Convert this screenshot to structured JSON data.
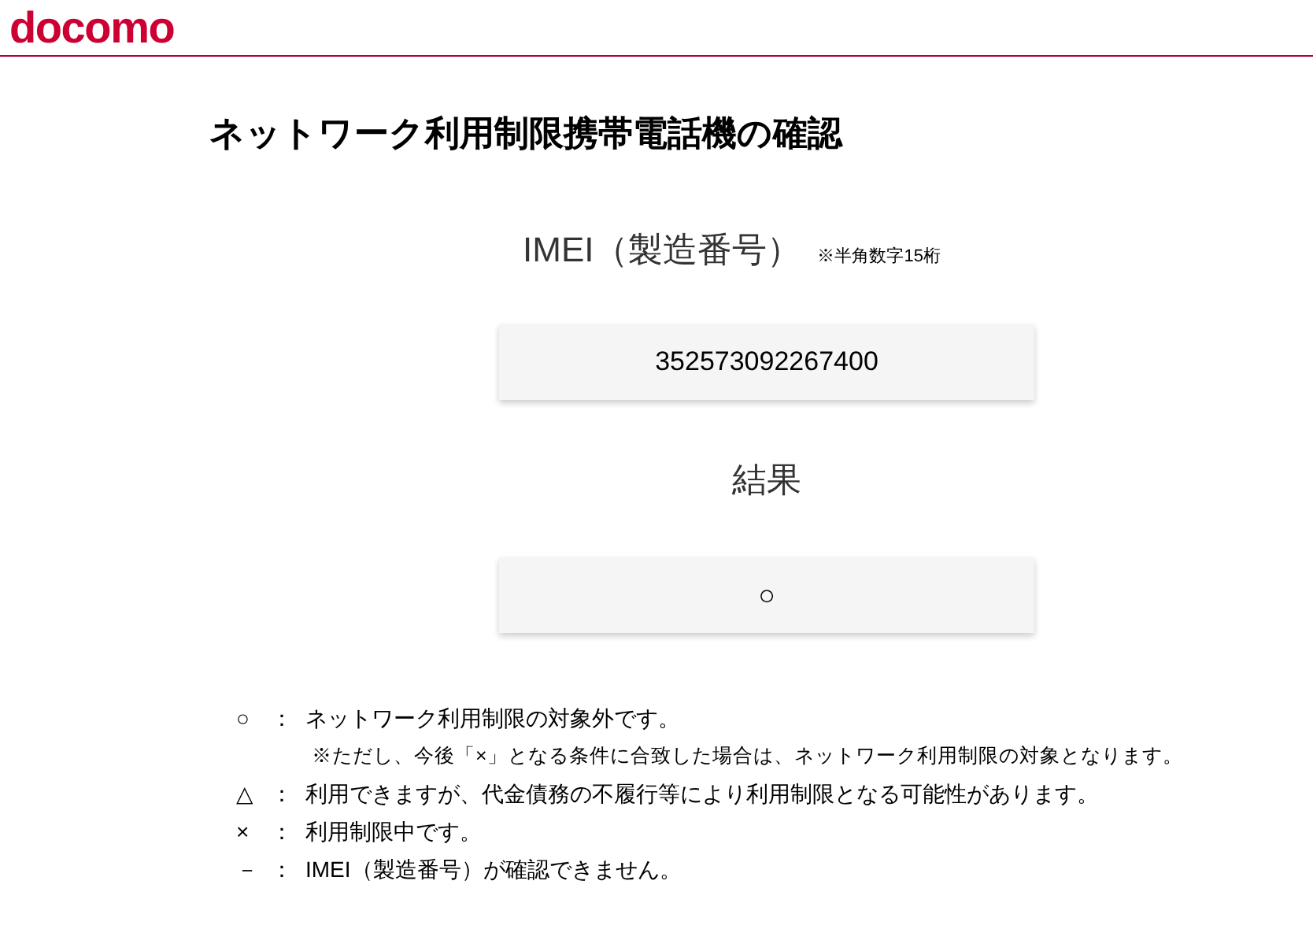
{
  "header": {
    "logo": "docomo"
  },
  "title": "ネットワーク利用制限携帯電話機の確認",
  "imei": {
    "label": "IMEI（製造番号）",
    "hint": "※半角数字15桁",
    "value": "352573092267400"
  },
  "result": {
    "label": "結果",
    "value": "○"
  },
  "legend": [
    {
      "symbol": "○",
      "separator": "：",
      "text": "ネットワーク利用制限の対象外です。",
      "note": "※ただし、今後「×」となる条件に合致した場合は、ネットワーク利用制限の対象となります。"
    },
    {
      "symbol": "△",
      "separator": "：",
      "text": "利用できますが、代金債務の不履行等により利用制限となる可能性があります。"
    },
    {
      "symbol": "×",
      "separator": "：",
      "text": "利用制限中です。"
    },
    {
      "symbol": "－",
      "separator": "：",
      "text": "IMEI（製造番号）が確認できません。"
    }
  ]
}
